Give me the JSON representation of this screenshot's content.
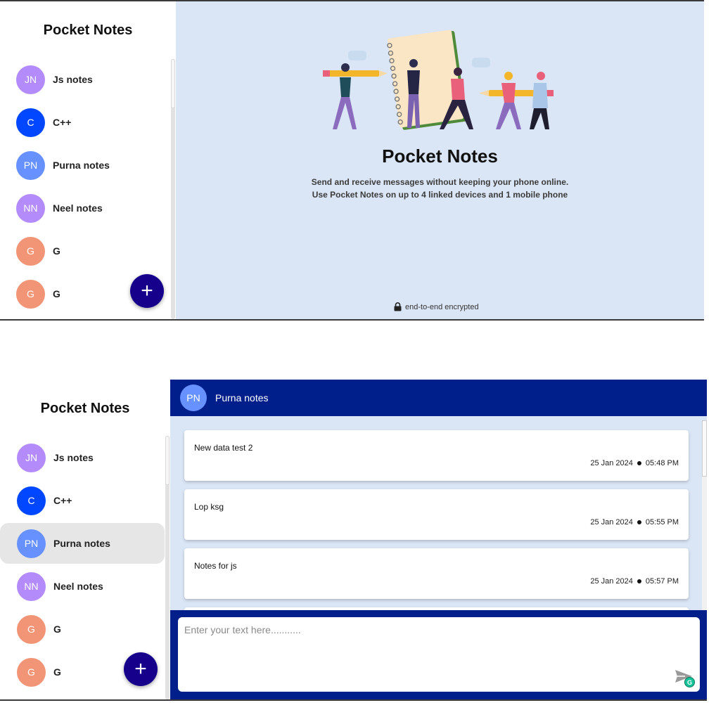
{
  "colors": {
    "accent": "#16008b",
    "header": "#001f8b",
    "main_bg": "#dae5f5"
  },
  "shot1": {
    "sidebar": {
      "title": "Pocket Notes",
      "groups": [
        {
          "initials": "JN",
          "name": "Js notes",
          "color": "#b38bfa"
        },
        {
          "initials": "C",
          "name": "C++",
          "color": "#0047ff"
        },
        {
          "initials": "PN",
          "name": "Purna notes",
          "color": "#6691ff"
        },
        {
          "initials": "NN",
          "name": "Neel notes",
          "color": "#b38bfa"
        },
        {
          "initials": "G",
          "name": "G",
          "color": "#f19576"
        },
        {
          "initials": "G",
          "name": "G",
          "color": "#f19576"
        }
      ],
      "add_icon": "plus-icon",
      "add_label": "+"
    },
    "welcome": {
      "title": "Pocket Notes",
      "line1": "Send and receive messages without keeping your phone online.",
      "line2": "Use Pocket Notes on up to 4 linked devices and 1 mobile phone",
      "encrypted_icon": "lock-icon",
      "encrypted_text": "end-to-end encrypted"
    }
  },
  "shot2": {
    "sidebar": {
      "title": "Pocket Notes",
      "selected": "Purna notes",
      "groups": [
        {
          "initials": "JN",
          "name": "Js notes",
          "color": "#b38bfa"
        },
        {
          "initials": "C",
          "name": "C++",
          "color": "#0047ff"
        },
        {
          "initials": "PN",
          "name": "Purna notes",
          "color": "#6691ff"
        },
        {
          "initials": "NN",
          "name": "Neel notes",
          "color": "#b38bfa"
        },
        {
          "initials": "G",
          "name": "G",
          "color": "#f19576"
        },
        {
          "initials": "G",
          "name": "G",
          "color": "#f19576"
        }
      ],
      "add_label": "+"
    },
    "chat": {
      "header": {
        "initials": "PN",
        "name": "Purna notes",
        "color": "#6691ff"
      },
      "notes": [
        {
          "text": "New data test 2",
          "date": "25 Jan 2024",
          "time": "05:48 PM"
        },
        {
          "text": "Lop ksg",
          "date": "25 Jan 2024",
          "time": "05:55 PM"
        },
        {
          "text": "Notes for js",
          "date": "25 Jan 2024",
          "time": "05:57 PM"
        }
      ],
      "input_placeholder": "Enter your text here...........",
      "send_icon": "send-icon",
      "grammarly_label": "G"
    }
  }
}
